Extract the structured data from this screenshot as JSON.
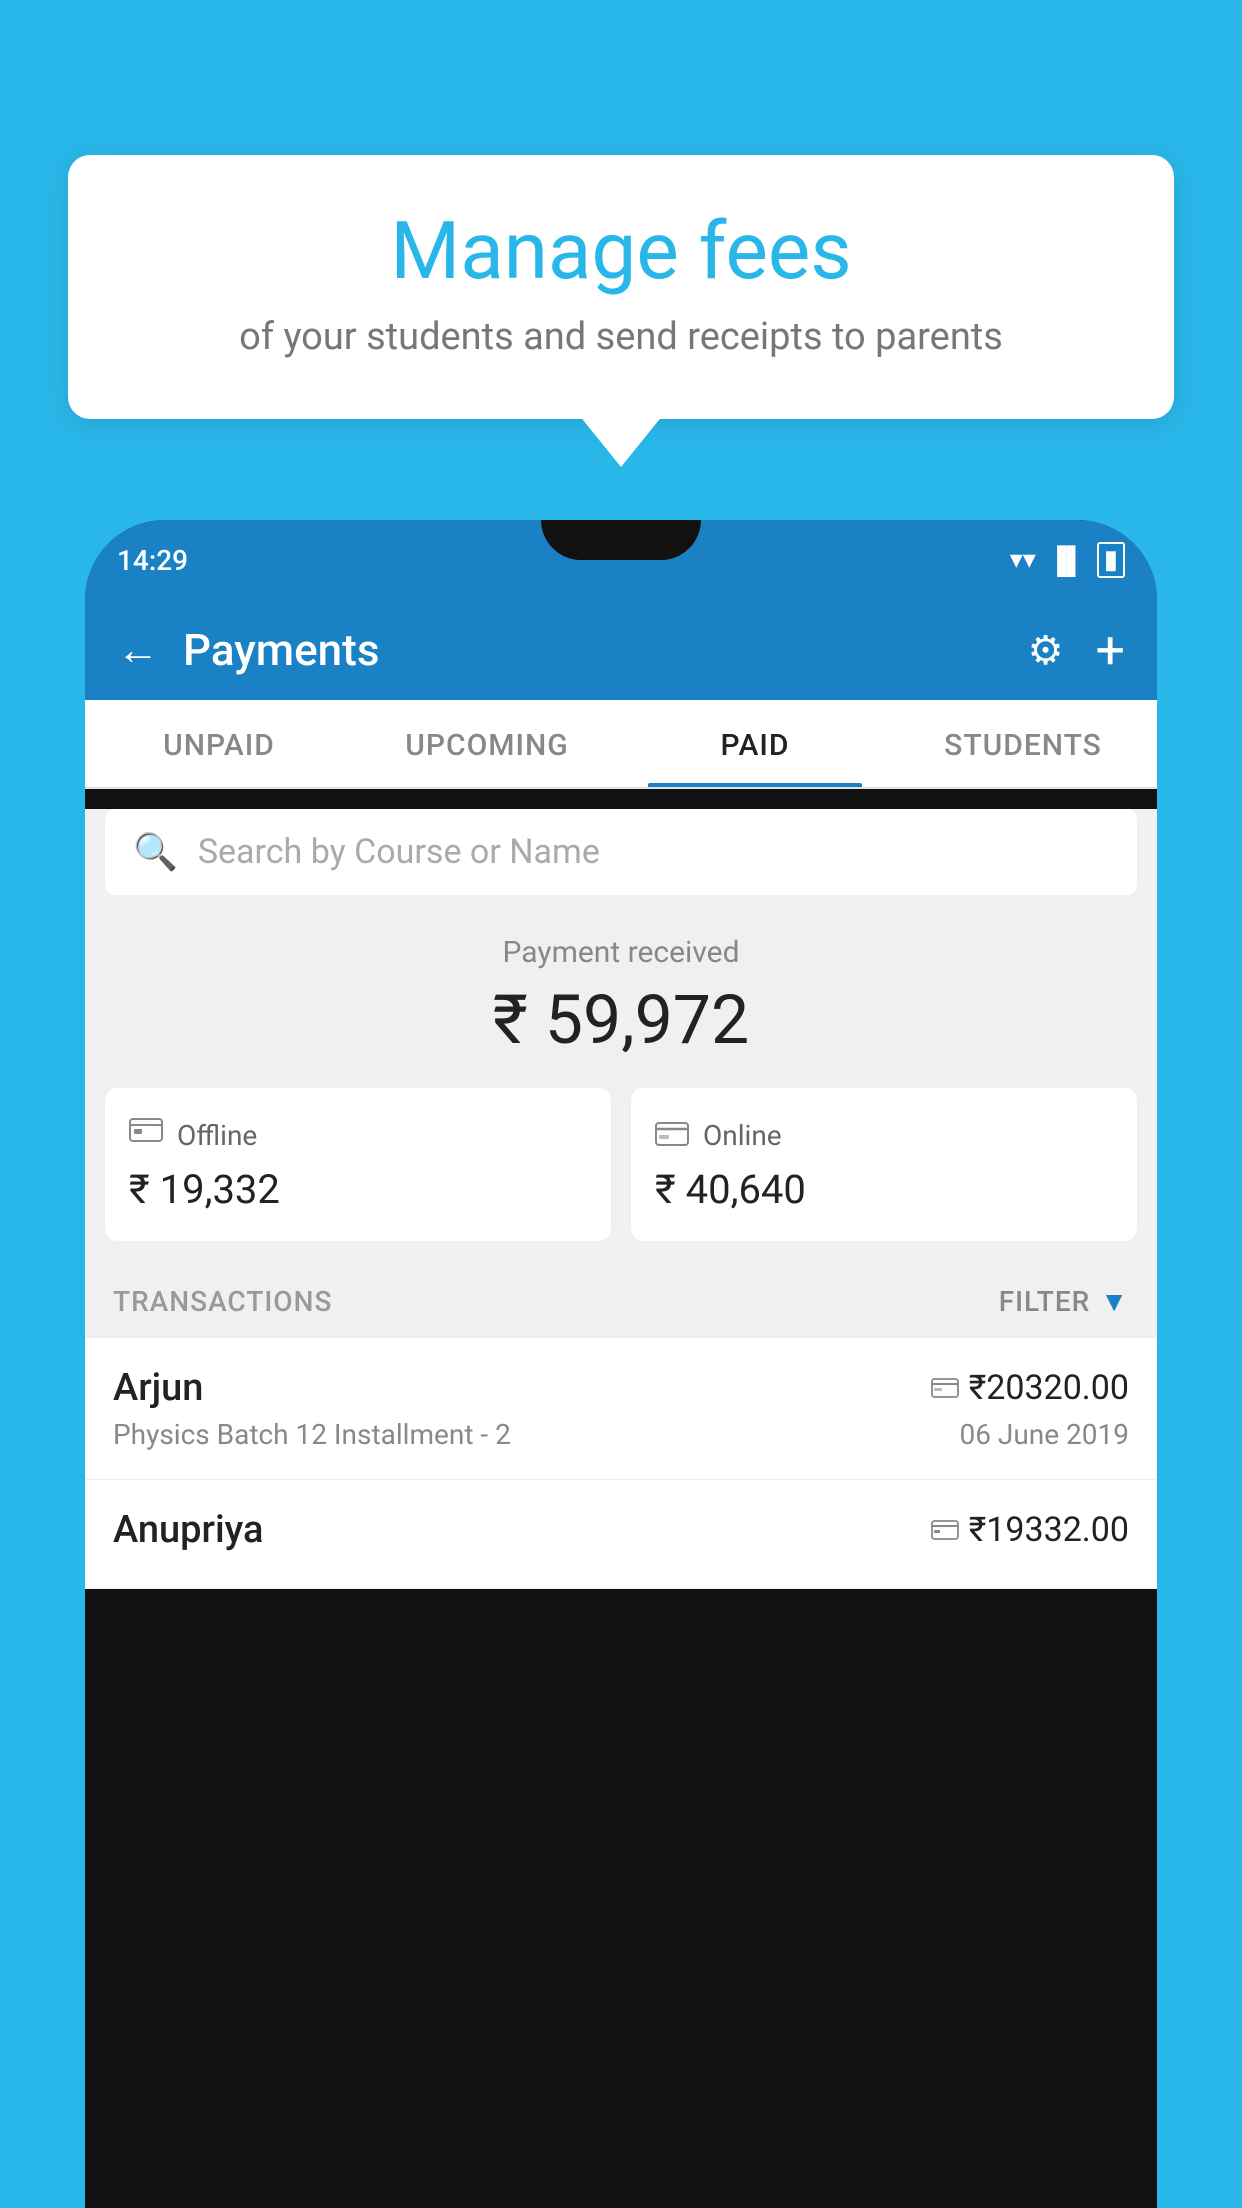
{
  "background_color": "#29b6e8",
  "tooltip": {
    "title": "Manage fees",
    "subtitle": "of your students and send receipts to parents"
  },
  "status_bar": {
    "time": "14:29"
  },
  "header": {
    "title": "Payments",
    "back_label": "←",
    "settings_label": "⚙",
    "add_label": "+"
  },
  "tabs": [
    {
      "id": "unpaid",
      "label": "UNPAID",
      "active": false
    },
    {
      "id": "upcoming",
      "label": "UPCOMING",
      "active": false
    },
    {
      "id": "paid",
      "label": "PAID",
      "active": true
    },
    {
      "id": "students",
      "label": "STUDENTS",
      "active": false
    }
  ],
  "search": {
    "placeholder": "Search by Course or Name"
  },
  "payment_summary": {
    "received_label": "Payment received",
    "total_amount": "₹ 59,972",
    "offline": {
      "icon": "💳",
      "label": "Offline",
      "amount": "₹ 19,332"
    },
    "online": {
      "icon": "💳",
      "label": "Online",
      "amount": "₹ 40,640"
    }
  },
  "transactions": {
    "label": "TRANSACTIONS",
    "filter_label": "FILTER",
    "rows": [
      {
        "name": "Arjun",
        "amount": "₹20320.00",
        "course": "Physics Batch 12 Installment - 2",
        "date": "06 June 2019",
        "payment_type": "online"
      },
      {
        "name": "Anupriya",
        "amount": "₹19332.00",
        "course": "",
        "date": "",
        "payment_type": "offline"
      }
    ]
  }
}
